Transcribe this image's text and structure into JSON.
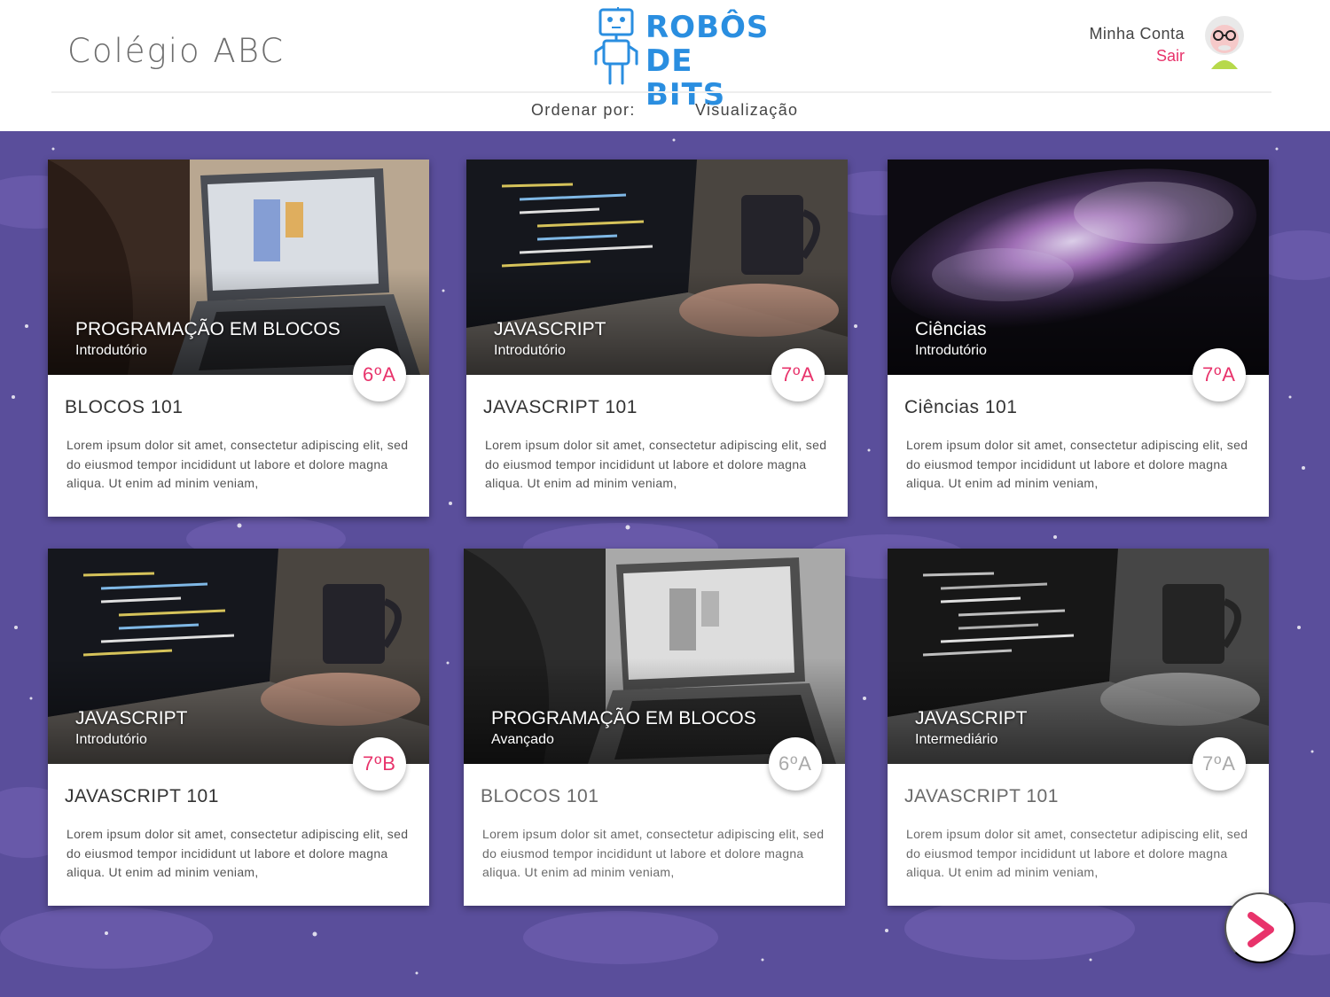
{
  "header": {
    "school_name": "Colégio ABC",
    "logo_text_line1": "ROBÔS",
    "logo_text_line2": "DE BITS",
    "account_label": "Minha Conta",
    "logout_label": "Sair"
  },
  "toolbar": {
    "sort_label": "Ordenar por:",
    "view_label": "Visualização"
  },
  "courses": [
    {
      "image_title": "PROGRAMAÇÃO EM BLOCOS",
      "level": "Introdutório",
      "grade": "6ºA",
      "title": "BLOCOS 101",
      "description": "Lorem ipsum dolor sit amet, consectetur adipiscing elit, sed do eiusmod tempor incididunt ut labore et dolore magna aliqua. Ut enim ad minim veniam,",
      "image": "laptop-blocks",
      "state": "active"
    },
    {
      "image_title": "JAVASCRIPT",
      "level": "Introdutório",
      "grade": "7ºA",
      "title": "JAVASCRIPT 101",
      "description": "Lorem ipsum dolor sit amet, consectetur adipiscing elit, sed do eiusmod tempor incididunt ut labore et dolore magna aliqua. Ut enim ad minim veniam,",
      "image": "laptop-code",
      "state": "active"
    },
    {
      "image_title": "Ciências",
      "level": "Introdutório",
      "grade": "7ºA",
      "title": "Ciências 101",
      "description": "Lorem ipsum dolor sit amet, consectetur adipiscing elit, sed do eiusmod tempor incididunt ut labore et dolore magna aliqua. Ut enim ad minim veniam,",
      "image": "nebula",
      "state": "active"
    },
    {
      "image_title": "JAVASCRIPT",
      "level": "Introdutório",
      "grade": "7ºB",
      "title": "JAVASCRIPT 101",
      "description": "Lorem ipsum dolor sit amet, consectetur adipiscing elit, sed do eiusmod tempor incididunt ut labore et dolore magna aliqua. Ut enim ad minim veniam,",
      "image": "laptop-code",
      "state": "active"
    },
    {
      "image_title": "PROGRAMAÇÃO EM BLOCOS",
      "level": "Avançado",
      "grade": "6ºA",
      "title": "BLOCOS 101",
      "description": "Lorem ipsum dolor sit amet, consectetur adipiscing elit, sed do eiusmod tempor incididunt ut labore et dolore magna aliqua. Ut enim ad minim veniam,",
      "image": "laptop-blocks",
      "state": "inactive"
    },
    {
      "image_title": "JAVASCRIPT",
      "level": "Intermediário",
      "grade": "7ºA",
      "title": "JAVASCRIPT 101",
      "description": "Lorem ipsum dolor sit amet, consectetur adipiscing elit, sed do eiusmod tempor incididunt ut labore et dolore magna aliqua. Ut enim ad minim veniam,",
      "image": "laptop-code",
      "state": "inactive"
    }
  ],
  "pagination": {
    "next_icon": "chevron-right-icon"
  },
  "colors": {
    "accent": "#e8336b",
    "background": "#5b4f9a",
    "logo": "#2a8ee0"
  }
}
